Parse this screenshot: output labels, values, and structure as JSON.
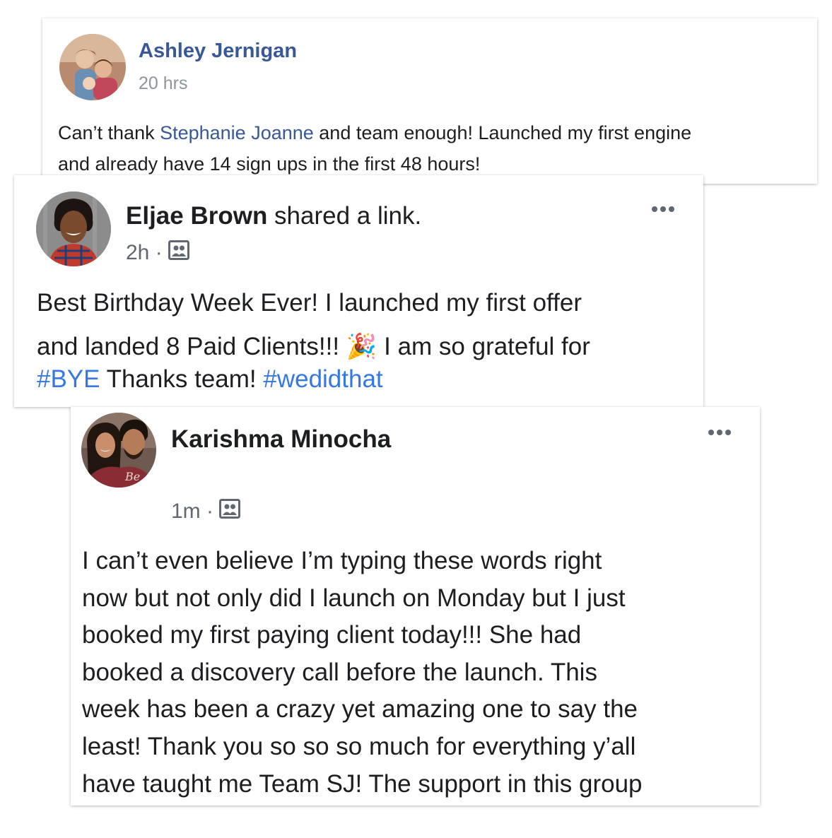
{
  "posts": [
    {
      "author": "Ashley Jernigan",
      "time": "20 hrs",
      "text_before": "Can’t thank ",
      "mention": "Stephanie Joanne",
      "text_line1_after": " and team enough! Launched my first engine",
      "text_line2": "and already have 14 sign ups in the first 48 hours!"
    },
    {
      "author": "Eljae Brown",
      "action": " shared a link.",
      "time": "2h ·",
      "line1": "Best Birthday Week Ever! I launched my first offer",
      "line2_before": "and landed 8 Paid Clients!!! ",
      "emoji": "🎉",
      "line2_after": " I am so grateful for",
      "hashtag1": "#BYE",
      "line3_mid": " Thanks team! ",
      "hashtag2": "#wedidthat",
      "audience_icon": "group-icon",
      "menu_icon": "more-dots-icon"
    },
    {
      "author": "Karishma Minocha",
      "time": "1m ·",
      "lines": [
        "I can’t even believe I’m typing these words right",
        "now but not only did I launch on Monday but I just",
        "booked my first paying client today!!! She had",
        "booked a discovery call before the launch. This",
        "week has been a crazy yet amazing one to say the",
        "least! Thank you so so so much for everything y’all",
        "have taught me Team SJ! The support in this group"
      ],
      "audience_icon": "group-icon",
      "menu_icon": "more-dots-icon"
    }
  ],
  "colors": {
    "link_blue": "#385898",
    "hashtag_blue": "#3578e5",
    "text": "#1c1e21",
    "muted": "#616770"
  }
}
